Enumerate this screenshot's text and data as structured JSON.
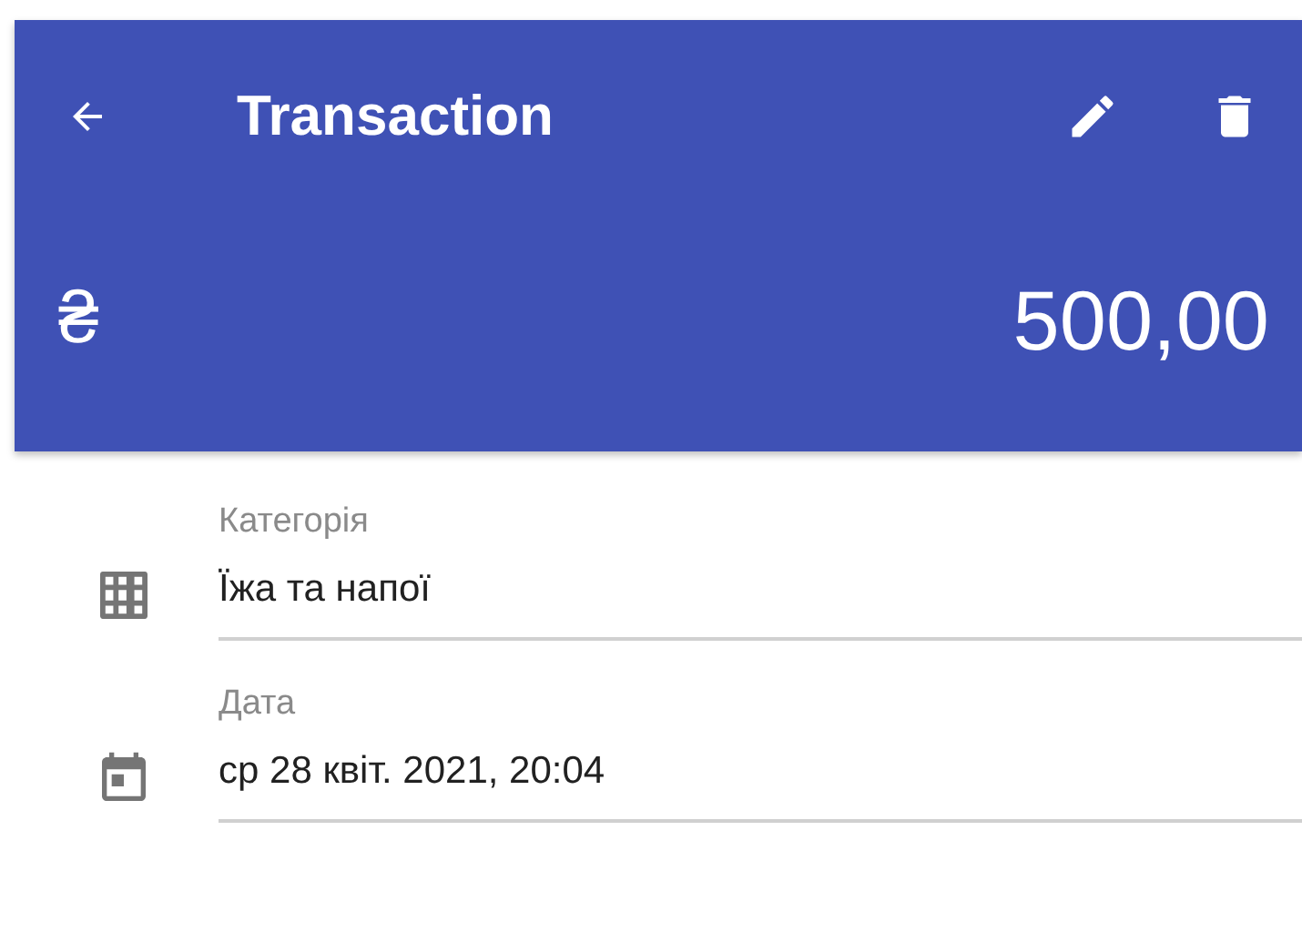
{
  "toolbar": {
    "title": "Transaction"
  },
  "amount": {
    "currency": "₴",
    "value": "500,00"
  },
  "fields": [
    {
      "kind": "category",
      "label": "Категорія",
      "value": "Їжа та напої"
    },
    {
      "kind": "date",
      "label": "Дата",
      "value": "ср 28 квіт. 2021, 20:04"
    }
  ]
}
